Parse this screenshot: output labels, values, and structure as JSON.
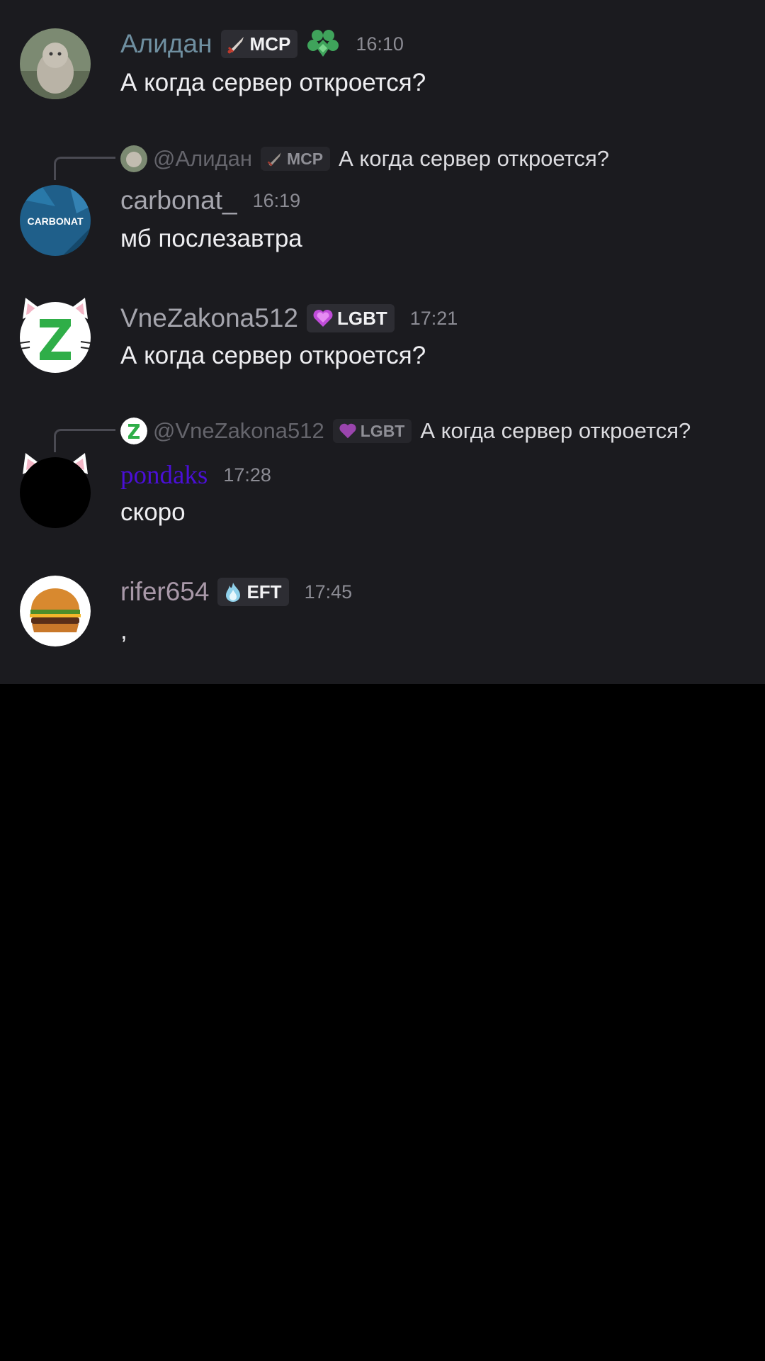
{
  "messages": [
    {
      "username": "Алидан",
      "username_color": "#6f8fa0",
      "badge": {
        "label": "MCP",
        "icon": "sword-icon"
      },
      "extra_icon": "green-heart-icon",
      "time": "16:10",
      "text": "А когда сервер откроется?"
    },
    {
      "reply": {
        "name": "@Алидан",
        "badge": "MCP",
        "text": "А когда сервер откроется?"
      },
      "username": "carbonat_",
      "username_color": "#a6a6ae",
      "avatar_text": "CARBONAT",
      "time": "16:19",
      "text": "мб послезавтра"
    },
    {
      "username": "VneZakona512",
      "username_color": "#a5a5ad",
      "badge": {
        "label": "LGBT",
        "icon": "heart-icon"
      },
      "time": "17:21",
      "text": "А когда сервер откроется?"
    },
    {
      "reply": {
        "name": "@VneZakona512",
        "badge": "LGBT",
        "text": "А когда сервер откроется?"
      },
      "username": "pondaks",
      "username_color": "#4a0fd6",
      "time": "17:28",
      "text": "скоро"
    },
    {
      "username": "rifer654",
      "username_color": "#a898a8",
      "badge": {
        "label": "EFT",
        "icon": "flame-icon"
      },
      "time": "17:45",
      "text": ","
    }
  ]
}
